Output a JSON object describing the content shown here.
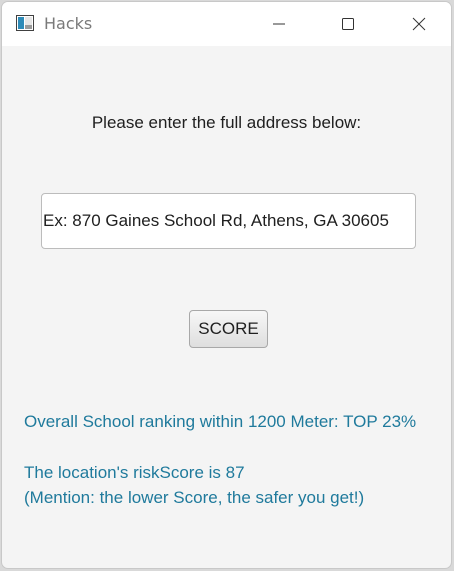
{
  "window": {
    "title": "Hacks",
    "icons": {
      "app": "app-window-icon",
      "minimize": "minimize-icon",
      "maximize": "maximize-icon",
      "close": "close-icon"
    }
  },
  "form": {
    "prompt": "Please enter the full address below:",
    "address_value": "",
    "address_placeholder": "Ex: 870 Gaines School Rd, Athens, GA 30605",
    "score_button_label": "SCORE"
  },
  "results": {
    "ranking": "Overall School ranking within 1200 Meter: TOP 23%",
    "risk_score": "The location's riskScore is 87",
    "mention": "(Mention: the lower Score, the safer you get!)"
  },
  "colors": {
    "result_text": "#1f7a9c",
    "window_background": "#f4f4f4",
    "titlebar_background": "#ffffff"
  }
}
